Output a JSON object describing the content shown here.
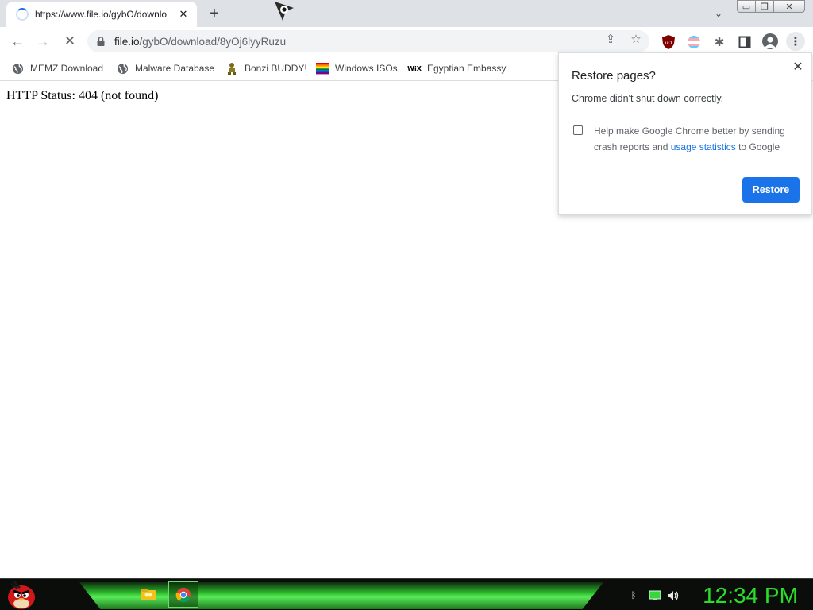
{
  "browser": {
    "tab": {
      "title": "https://www.file.io/gybO/downlo",
      "close_glyph": "✕"
    },
    "new_tab_glyph": "+",
    "tab_search_glyph": "⌄",
    "window_controls": {
      "minimize": "▭",
      "maximize": "❐",
      "close": "✕"
    },
    "toolbar": {
      "back_glyph": "←",
      "forward_glyph": "→",
      "reload_glyph": "✕",
      "url_host": "file.io",
      "url_path": "/gybO/download/8yOj6lyyRuzu",
      "share_glyph": "⇪",
      "star_glyph": "☆",
      "puzzle_glyph": "✱",
      "menu_glyph": "⋮"
    },
    "bookmarks": [
      {
        "label": "MEMZ Download",
        "icon": "globe-icon"
      },
      {
        "label": "Malware Database",
        "icon": "globe-icon"
      },
      {
        "label": "Bonzi BUDDY!",
        "icon": "bonzi-icon"
      },
      {
        "label": "Windows ISOs",
        "icon": "rainbow-flag-icon"
      },
      {
        "label": "Egyptian Embassy",
        "icon": "wix-icon"
      }
    ]
  },
  "page": {
    "status_text": "HTTP Status: 404 (not found)"
  },
  "restore_popup": {
    "heading": "Restore pages?",
    "message": "Chrome didn't shut down correctly.",
    "close_glyph": "✕",
    "checkbox_label_before": "Help make Google Chrome better by sending crash reports and ",
    "checkbox_link": "usage statistics",
    "checkbox_label_after": " to Google",
    "checkbox_checked": false,
    "restore_button": "Restore"
  },
  "taskbar": {
    "clock": "12:34 PM",
    "tray_icons": [
      "bluetooth-icon",
      "network-icon",
      "volume-icon"
    ],
    "tray_glyphs": [
      "ᛒ",
      "",
      "🔊"
    ]
  },
  "colors": {
    "accent": "#1a73e8",
    "clock_green": "#2bdc2b",
    "taskbar_glow": "#5df55d"
  }
}
